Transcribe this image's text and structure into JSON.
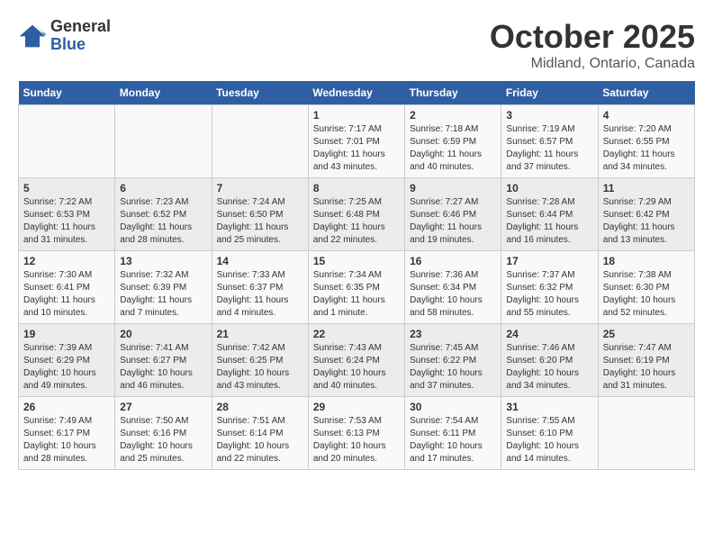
{
  "header": {
    "logo_line1": "General",
    "logo_line2": "Blue",
    "month": "October 2025",
    "location": "Midland, Ontario, Canada"
  },
  "weekdays": [
    "Sunday",
    "Monday",
    "Tuesday",
    "Wednesday",
    "Thursday",
    "Friday",
    "Saturday"
  ],
  "weeks": [
    [
      {
        "day": "",
        "info": ""
      },
      {
        "day": "",
        "info": ""
      },
      {
        "day": "",
        "info": ""
      },
      {
        "day": "1",
        "info": "Sunrise: 7:17 AM\nSunset: 7:01 PM\nDaylight: 11 hours and 43 minutes."
      },
      {
        "day": "2",
        "info": "Sunrise: 7:18 AM\nSunset: 6:59 PM\nDaylight: 11 hours and 40 minutes."
      },
      {
        "day": "3",
        "info": "Sunrise: 7:19 AM\nSunset: 6:57 PM\nDaylight: 11 hours and 37 minutes."
      },
      {
        "day": "4",
        "info": "Sunrise: 7:20 AM\nSunset: 6:55 PM\nDaylight: 11 hours and 34 minutes."
      }
    ],
    [
      {
        "day": "5",
        "info": "Sunrise: 7:22 AM\nSunset: 6:53 PM\nDaylight: 11 hours and 31 minutes."
      },
      {
        "day": "6",
        "info": "Sunrise: 7:23 AM\nSunset: 6:52 PM\nDaylight: 11 hours and 28 minutes."
      },
      {
        "day": "7",
        "info": "Sunrise: 7:24 AM\nSunset: 6:50 PM\nDaylight: 11 hours and 25 minutes."
      },
      {
        "day": "8",
        "info": "Sunrise: 7:25 AM\nSunset: 6:48 PM\nDaylight: 11 hours and 22 minutes."
      },
      {
        "day": "9",
        "info": "Sunrise: 7:27 AM\nSunset: 6:46 PM\nDaylight: 11 hours and 19 minutes."
      },
      {
        "day": "10",
        "info": "Sunrise: 7:28 AM\nSunset: 6:44 PM\nDaylight: 11 hours and 16 minutes."
      },
      {
        "day": "11",
        "info": "Sunrise: 7:29 AM\nSunset: 6:42 PM\nDaylight: 11 hours and 13 minutes."
      }
    ],
    [
      {
        "day": "12",
        "info": "Sunrise: 7:30 AM\nSunset: 6:41 PM\nDaylight: 11 hours and 10 minutes."
      },
      {
        "day": "13",
        "info": "Sunrise: 7:32 AM\nSunset: 6:39 PM\nDaylight: 11 hours and 7 minutes."
      },
      {
        "day": "14",
        "info": "Sunrise: 7:33 AM\nSunset: 6:37 PM\nDaylight: 11 hours and 4 minutes."
      },
      {
        "day": "15",
        "info": "Sunrise: 7:34 AM\nSunset: 6:35 PM\nDaylight: 11 hours and 1 minute."
      },
      {
        "day": "16",
        "info": "Sunrise: 7:36 AM\nSunset: 6:34 PM\nDaylight: 10 hours and 58 minutes."
      },
      {
        "day": "17",
        "info": "Sunrise: 7:37 AM\nSunset: 6:32 PM\nDaylight: 10 hours and 55 minutes."
      },
      {
        "day": "18",
        "info": "Sunrise: 7:38 AM\nSunset: 6:30 PM\nDaylight: 10 hours and 52 minutes."
      }
    ],
    [
      {
        "day": "19",
        "info": "Sunrise: 7:39 AM\nSunset: 6:29 PM\nDaylight: 10 hours and 49 minutes."
      },
      {
        "day": "20",
        "info": "Sunrise: 7:41 AM\nSunset: 6:27 PM\nDaylight: 10 hours and 46 minutes."
      },
      {
        "day": "21",
        "info": "Sunrise: 7:42 AM\nSunset: 6:25 PM\nDaylight: 10 hours and 43 minutes."
      },
      {
        "day": "22",
        "info": "Sunrise: 7:43 AM\nSunset: 6:24 PM\nDaylight: 10 hours and 40 minutes."
      },
      {
        "day": "23",
        "info": "Sunrise: 7:45 AM\nSunset: 6:22 PM\nDaylight: 10 hours and 37 minutes."
      },
      {
        "day": "24",
        "info": "Sunrise: 7:46 AM\nSunset: 6:20 PM\nDaylight: 10 hours and 34 minutes."
      },
      {
        "day": "25",
        "info": "Sunrise: 7:47 AM\nSunset: 6:19 PM\nDaylight: 10 hours and 31 minutes."
      }
    ],
    [
      {
        "day": "26",
        "info": "Sunrise: 7:49 AM\nSunset: 6:17 PM\nDaylight: 10 hours and 28 minutes."
      },
      {
        "day": "27",
        "info": "Sunrise: 7:50 AM\nSunset: 6:16 PM\nDaylight: 10 hours and 25 minutes."
      },
      {
        "day": "28",
        "info": "Sunrise: 7:51 AM\nSunset: 6:14 PM\nDaylight: 10 hours and 22 minutes."
      },
      {
        "day": "29",
        "info": "Sunrise: 7:53 AM\nSunset: 6:13 PM\nDaylight: 10 hours and 20 minutes."
      },
      {
        "day": "30",
        "info": "Sunrise: 7:54 AM\nSunset: 6:11 PM\nDaylight: 10 hours and 17 minutes."
      },
      {
        "day": "31",
        "info": "Sunrise: 7:55 AM\nSunset: 6:10 PM\nDaylight: 10 hours and 14 minutes."
      },
      {
        "day": "",
        "info": ""
      }
    ]
  ]
}
